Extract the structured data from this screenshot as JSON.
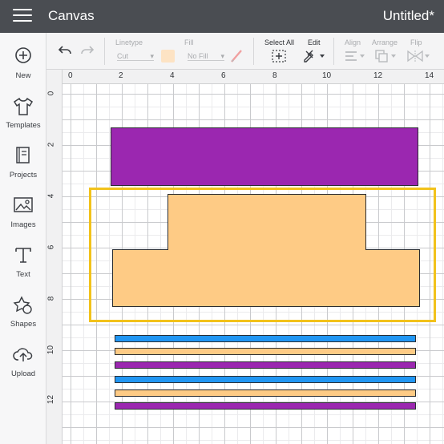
{
  "topbar": {
    "app_title": "Canvas",
    "doc_title": "Untitled*"
  },
  "sidebar": {
    "items": [
      {
        "label": "New",
        "icon": "plus-circle-icon"
      },
      {
        "label": "Templates",
        "icon": "tshirt-icon"
      },
      {
        "label": "Projects",
        "icon": "projects-icon"
      },
      {
        "label": "Images",
        "icon": "image-icon"
      },
      {
        "label": "Text",
        "icon": "text-icon"
      },
      {
        "label": "Shapes",
        "icon": "shapes-icon"
      },
      {
        "label": "Upload",
        "icon": "cloud-upload-icon"
      }
    ]
  },
  "toolbar": {
    "linetype_label": "Linetype",
    "linetype_value": "Cut",
    "fill_label": "Fill",
    "fill_value": "No Fill",
    "select_all_label": "Select All",
    "edit_label": "Edit",
    "align_label": "Align",
    "arrange_label": "Arrange",
    "flip_label": "Flip"
  },
  "ruler": {
    "horizontal": [
      "0",
      "2",
      "4",
      "6",
      "8",
      "10",
      "12",
      "14"
    ],
    "vertical": [
      "0",
      "2",
      "4",
      "6",
      "8",
      "10",
      "12"
    ]
  },
  "colors": {
    "purple": "#9b27b0",
    "peach": "#fecb85",
    "blue": "#2196f3",
    "selection": "#f2c21b",
    "topbar": "#4a4d52"
  }
}
